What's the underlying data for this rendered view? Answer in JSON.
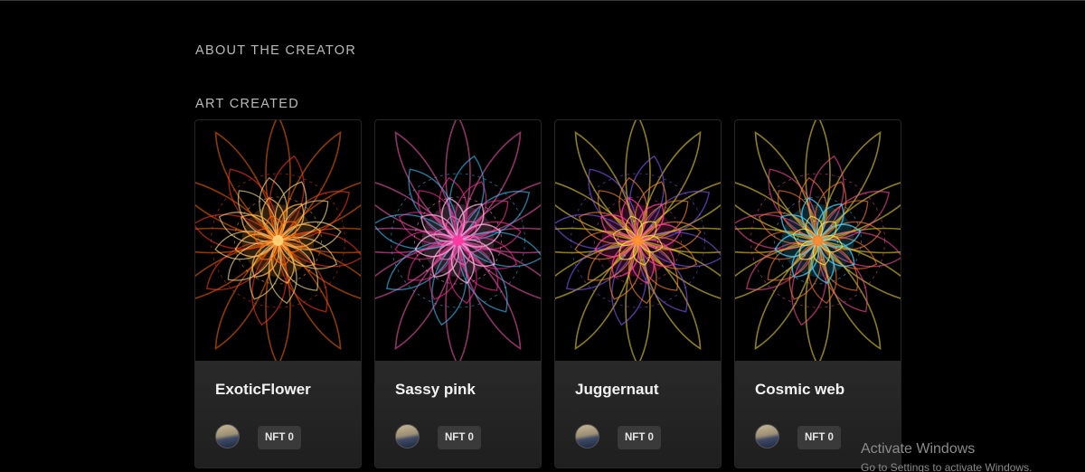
{
  "about_heading": "ABOUT THE CREATOR",
  "art_heading": "ART CREATED",
  "cards": [
    {
      "title": "ExoticFlower",
      "badge": "NFT 0",
      "palette": [
        "#ff6a00",
        "#ffb347",
        "#ff3b1f",
        "#ffe08a"
      ]
    },
    {
      "title": "Sassy pink",
      "badge": "NFT 0",
      "palette": [
        "#ff5fb8",
        "#ffb3e0",
        "#3ec6ff",
        "#ff2d9a"
      ]
    },
    {
      "title": "Juggernaut",
      "badge": "NFT 0",
      "palette": [
        "#ffe23a",
        "#ff3ca0",
        "#8a5cff",
        "#ff8a2a"
      ]
    },
    {
      "title": "Cosmic web",
      "badge": "NFT 0",
      "palette": [
        "#ffe23a",
        "#40d0ff",
        "#ff4fa0",
        "#ff7a2a"
      ]
    }
  ],
  "watermark": {
    "title": "Activate Windows",
    "subtitle": "Go to Settings to activate Windows."
  }
}
